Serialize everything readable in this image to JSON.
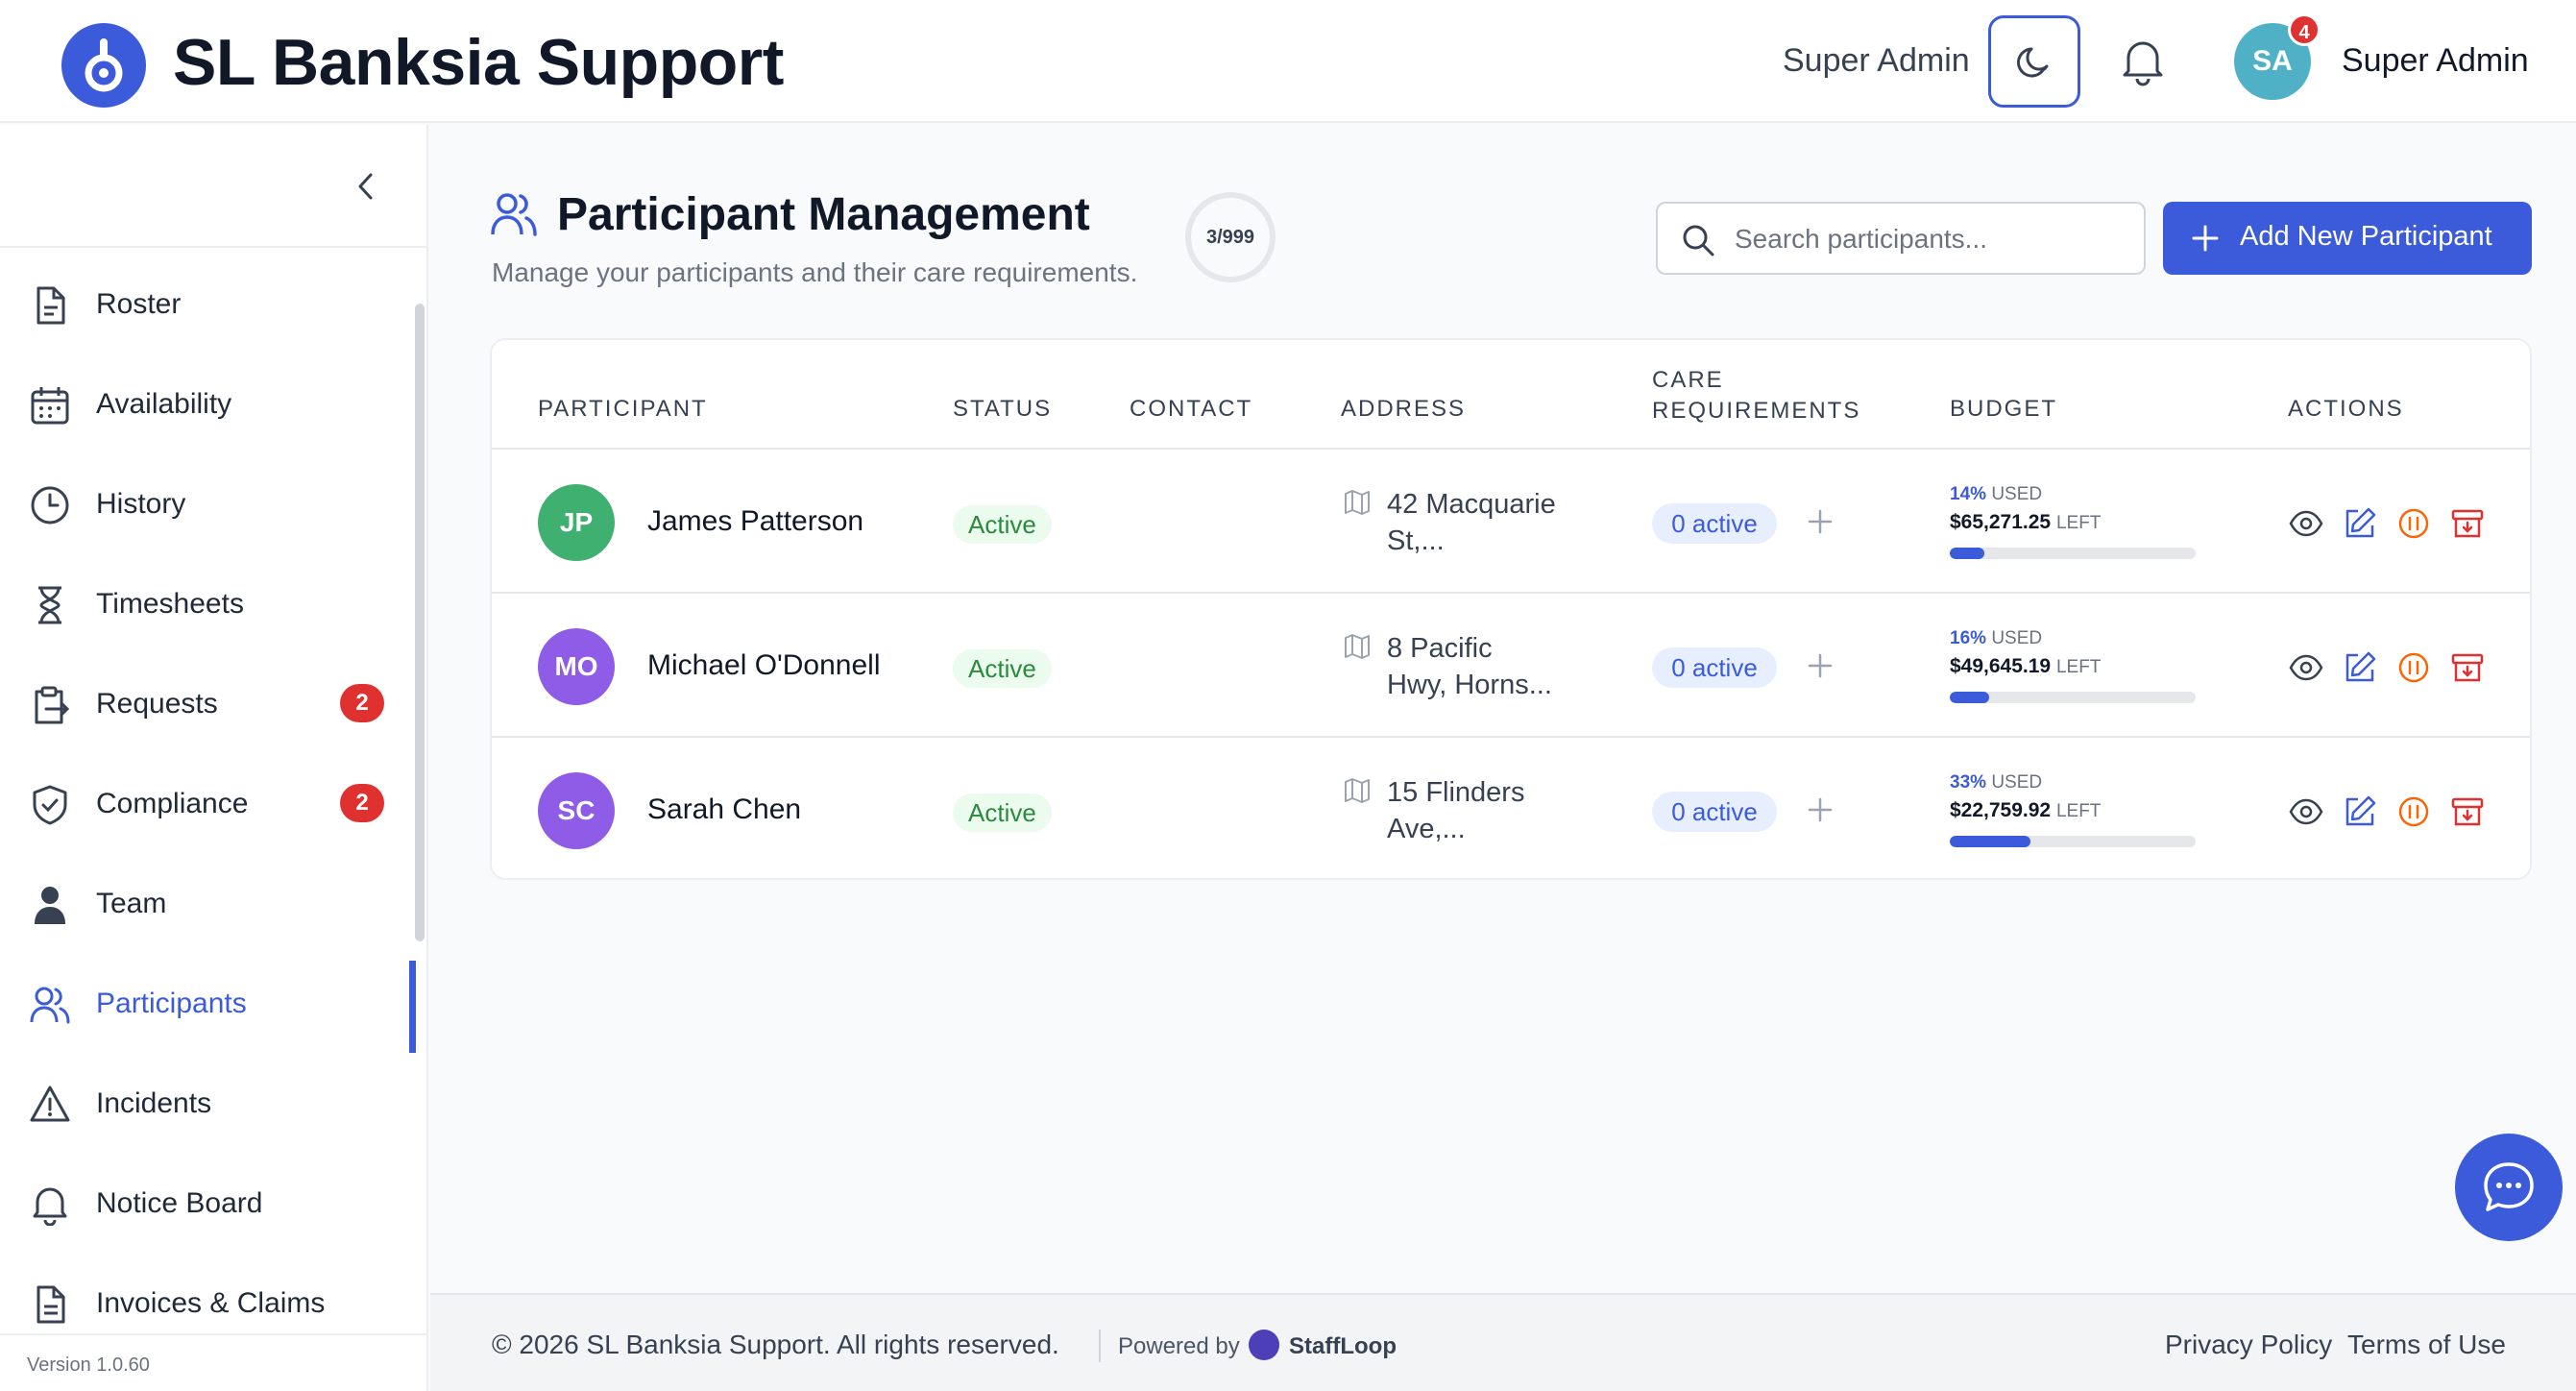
{
  "app": {
    "title": "SL Banksia Support"
  },
  "header": {
    "user_label_left": "Super Admin",
    "user_name": "Super Admin",
    "avatar_initials": "SA",
    "notification_count": "4"
  },
  "sidebar": {
    "items": [
      {
        "label": "Roster",
        "icon": "document-icon"
      },
      {
        "label": "Availability",
        "icon": "calendar-icon"
      },
      {
        "label": "History",
        "icon": "clock-icon"
      },
      {
        "label": "Timesheets",
        "icon": "hourglass-icon"
      },
      {
        "label": "Requests",
        "icon": "clipboard-export-icon",
        "badge": "2"
      },
      {
        "label": "Compliance",
        "icon": "shield-check-icon",
        "badge": "2"
      },
      {
        "label": "Team",
        "icon": "person-icon"
      },
      {
        "label": "Participants",
        "icon": "users-icon",
        "active": true
      },
      {
        "label": "Incidents",
        "icon": "warning-icon"
      },
      {
        "label": "Notice Board",
        "icon": "bell-icon"
      },
      {
        "label": "Invoices & Claims",
        "icon": "invoice-icon"
      }
    ],
    "version": "Version 1.0.60"
  },
  "page": {
    "title": "Participant Management",
    "subtitle": "Manage your participants and their care requirements.",
    "count": "3/999",
    "search_placeholder": "Search participants...",
    "add_button": "Add New Participant"
  },
  "table": {
    "headers": {
      "participant": "PARTICIPANT",
      "status": "STATUS",
      "contact": "CONTACT",
      "address": "ADDRESS",
      "care_line1": "CARE",
      "care_line2": "REQUIREMENTS",
      "budget": "BUDGET",
      "actions": "ACTIONS"
    },
    "rows": [
      {
        "initials": "JP",
        "name": "James Patterson",
        "status": "Active",
        "address_line1": "42 Macquarie",
        "address_line2": "St,...",
        "care": "0 active",
        "used_pct": "14%",
        "used_label": "USED",
        "left_amount": "$65,271.25",
        "left_label": "LEFT",
        "used_fraction": 0.14,
        "avatar_color": "#40b070"
      },
      {
        "initials": "MO",
        "name": "Michael O'Donnell",
        "status": "Active",
        "address_line1": "8 Pacific",
        "address_line2": "Hwy, Horns...",
        "care": "0 active",
        "used_pct": "16%",
        "used_label": "USED",
        "left_amount": "$49,645.19",
        "left_label": "LEFT",
        "used_fraction": 0.16,
        "avatar_color": "#8e5ce6"
      },
      {
        "initials": "SC",
        "name": "Sarah Chen",
        "status": "Active",
        "address_line1": "15 Flinders",
        "address_line2": "Ave,...",
        "care": "0 active",
        "used_pct": "33%",
        "used_label": "USED",
        "left_amount": "$22,759.92",
        "left_label": "LEFT",
        "used_fraction": 0.33,
        "avatar_color": "#8e5ce6"
      }
    ]
  },
  "footer": {
    "copyright": "© 2026 SL Banksia Support. All rights reserved.",
    "powered_by": "Powered by",
    "brand": "StaffLoop",
    "privacy": "Privacy Policy",
    "terms": "Terms of Use"
  },
  "colors": {
    "accent": "#3b5bdb",
    "danger": "#e03131",
    "success": "#2b8a3e",
    "warning": "#f76707"
  }
}
